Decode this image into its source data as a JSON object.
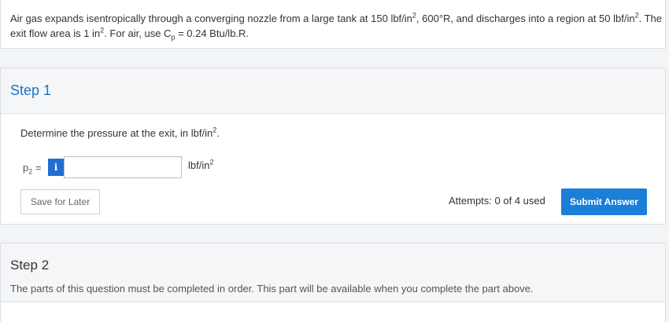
{
  "question": {
    "part1": "Air gas expands isentropically through a converging nozzle from a large tank at 150 lbf/in",
    "sup1": "2",
    "part2": ", 600°R, and discharges into a region at 50 lbf/in",
    "sup2": "2",
    "part3": ". The exit flow area is 1 in",
    "sup3": "2",
    "part4": ". For air, use C",
    "sub4": "p",
    "part5": " = 0.24 Btu/lb.R."
  },
  "step1": {
    "title": "Step 1",
    "prompt_text": "Determine the pressure at the exit, in lbf/in",
    "prompt_sup": "2",
    "prompt_end": ".",
    "var_label": "p",
    "var_sub": "2",
    "var_eq": " =",
    "info_icon_glyph": "i",
    "input_value": "",
    "unit_text": "lbf/in",
    "unit_sup": "2",
    "save_label": "Save for Later",
    "attempts_text": "Attempts: 0 of 4 used",
    "submit_label": "Submit Answer"
  },
  "step2": {
    "title": "Step 2",
    "note": "The parts of this question must be completed in order. This part will be available when you complete the part above."
  },
  "colors": {
    "accent": "#1b7fd8",
    "step_title": "#1a73c7",
    "info_button": "#1f6fd1"
  }
}
